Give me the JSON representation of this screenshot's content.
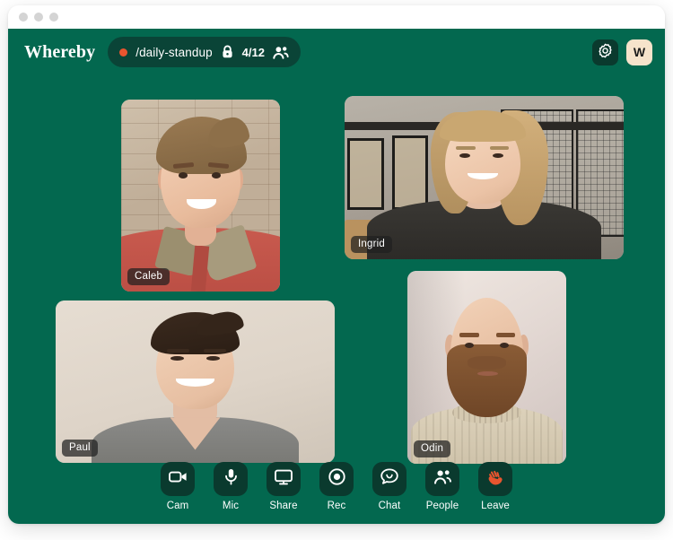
{
  "window": {
    "traffic_lights": [
      "close",
      "minimize",
      "maximize"
    ]
  },
  "header": {
    "brand": "Whereby",
    "room": {
      "recording_indicator": "rec-dot",
      "name": "/daily-standup",
      "lock_icon": "lock-icon",
      "count": "4/12",
      "people_icon": "people-icon"
    },
    "settings_icon": "gear-icon",
    "avatar_initial": "W"
  },
  "participants": [
    {
      "name": "Caleb",
      "tile": "tile-caleb",
      "orientation": "portrait"
    },
    {
      "name": "Ingrid",
      "tile": "tile-ingrid",
      "orientation": "landscape"
    },
    {
      "name": "Paul",
      "tile": "tile-paul",
      "orientation": "landscape"
    },
    {
      "name": "Odin",
      "tile": "tile-odin",
      "orientation": "portrait"
    }
  ],
  "controls": [
    {
      "label": "Cam",
      "icon": "video-camera-icon"
    },
    {
      "label": "Mic",
      "icon": "microphone-icon"
    },
    {
      "label": "Share",
      "icon": "monitor-icon"
    },
    {
      "label": "Rec",
      "icon": "record-icon"
    },
    {
      "label": "Chat",
      "icon": "chat-bubble-icon"
    },
    {
      "label": "People",
      "icon": "people-icon"
    },
    {
      "label": "Leave",
      "icon": "waving-hand-icon"
    }
  ],
  "colors": {
    "stage_green": "#03684F",
    "pill_green": "#0A4437",
    "button_green": "#0A3A2E",
    "accent_orange": "#E8552F",
    "avatar_cream": "#F6E3CB"
  }
}
